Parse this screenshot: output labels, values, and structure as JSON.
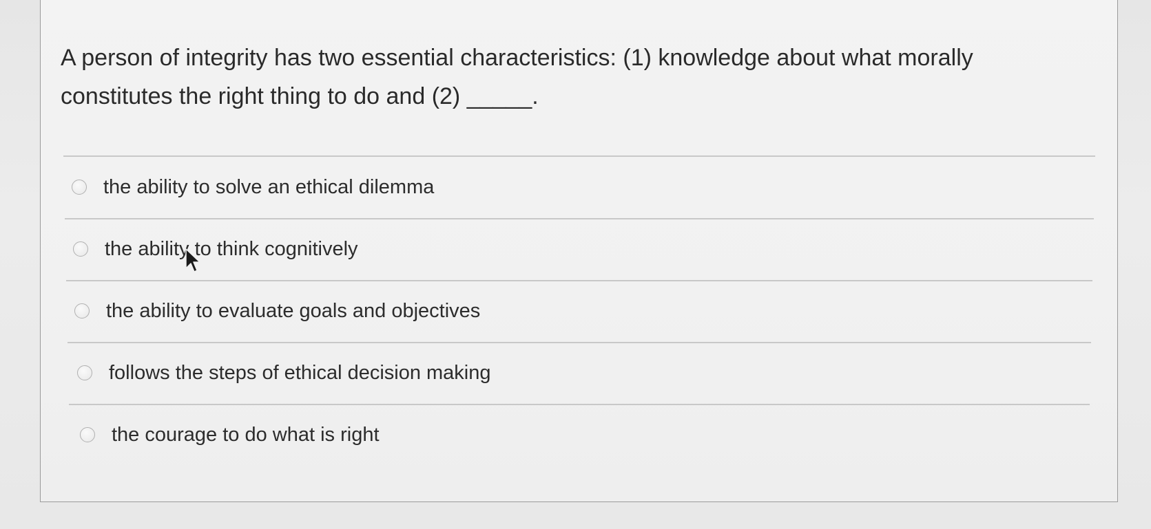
{
  "question": {
    "line1": "A person of integrity has two essential characteristics: (1) knowledge about what morally",
    "line2": "constitutes the right thing to do and (2) _____."
  },
  "options": [
    {
      "label": "the ability to solve an ethical dilemma",
      "selected": false
    },
    {
      "label": "the ability to think cognitively",
      "selected": false
    },
    {
      "label": "the ability to evaluate goals and objectives",
      "selected": false
    },
    {
      "label": "follows the steps of ethical decision making",
      "selected": false
    },
    {
      "label": "the courage to do what is right",
      "selected": false
    }
  ],
  "icons": {
    "cursor": "mouse-pointer-icon",
    "radio": "radio-button-icon"
  },
  "colors": {
    "background": "#e8e8e8",
    "card": "#f2f2f2",
    "text": "#2a2a2a",
    "divider": "#c8c8c8"
  }
}
